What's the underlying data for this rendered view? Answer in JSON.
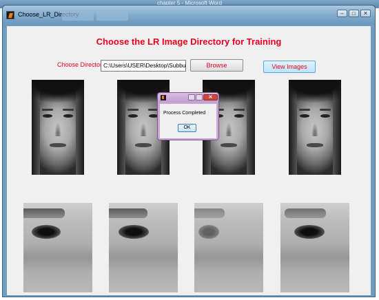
{
  "background_app": {
    "title": "chapter 5 - Microsoft Word"
  },
  "window": {
    "title": "Choose_LR_Directory",
    "taskbar_tabs": [
      "",
      ""
    ],
    "controls": {
      "minimize": "–",
      "maximize": "□",
      "close": "✕"
    }
  },
  "main": {
    "heading": "Choose the LR Image Directory for Training",
    "choose_label": "Choose Directory",
    "directory_value": "C:\\Users\\USER\\Desktop\\SubbuNewFina",
    "browse_label": "Browse",
    "view_images_label": "View Images"
  },
  "faces": [
    {
      "id": "face-1"
    },
    {
      "id": "face-2"
    },
    {
      "id": "face-3"
    },
    {
      "id": "face-4"
    }
  ],
  "eye_crops": [
    {
      "id": "crop-1"
    },
    {
      "id": "crop-2"
    },
    {
      "id": "crop-3"
    },
    {
      "id": "crop-4"
    }
  ],
  "dialog": {
    "message": "Process Completed",
    "ok_label": "OK",
    "close_glyph": "✕"
  },
  "colors": {
    "accent_red": "#e8001c",
    "title_blue": "#6f9cc1",
    "dialog_purple": "#c9a9d4"
  }
}
